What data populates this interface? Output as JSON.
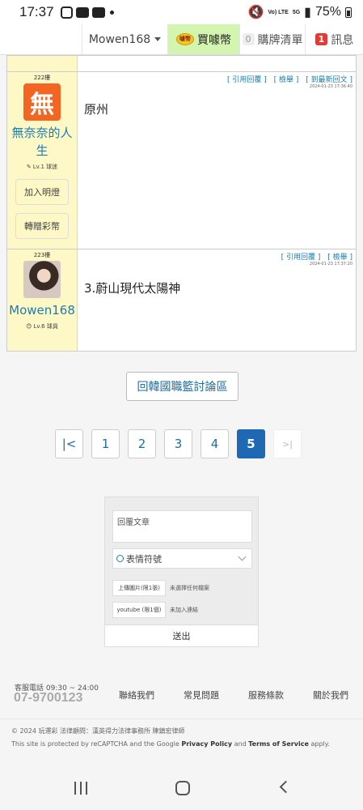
{
  "status_bar": {
    "time": "17:37",
    "network": "5G",
    "volte": "Vo) LTE",
    "battery": "75%"
  },
  "top_nav": {
    "username": "Mowen168",
    "buy_label": "買噱幣",
    "coin_text": "噱幣",
    "cart_count": "0",
    "cart_label": "購牌清單",
    "msg_count": "1",
    "msg_label": "訊息"
  },
  "posts": [
    {
      "floor": "222樓",
      "avatar_char": "無",
      "username": "無奈奈的人生",
      "level": "Lv.1 球迷",
      "actions": [
        "[ 引用回覆 ]",
        "[ 檢舉 ]",
        "[ 到最新回文 ]"
      ],
      "timestamp": "2024-01-23 17:36:40",
      "text": "原州",
      "buttons": [
        "加入明燈",
        "轉贈彩幣"
      ]
    },
    {
      "floor": "223樓",
      "username": "Mowen168",
      "level": "Lv.6 球員",
      "actions": [
        "[ 引用回覆 ]",
        "[ 檢舉 ]"
      ],
      "timestamp": "2024-01-23 17:37:20",
      "text": "3.蔚山現代太陽神"
    }
  ],
  "back_button": "回韓國職籃討論區",
  "pagination": {
    "first": "|<",
    "pages": [
      "1",
      "2",
      "3",
      "4",
      "5"
    ],
    "current": "5",
    "last": ">|"
  },
  "reply_form": {
    "placeholder": "回覆文章",
    "emoji_label": "表情符號",
    "image_button": "上傳圖片(限1張)",
    "image_note": "未選擇任何檔案",
    "youtube_button": "youtube (限1個)",
    "youtube_note": "未加入連結",
    "submit": "送出"
  },
  "footer": {
    "service_label": "客服電話 09:30 ~ 24:00",
    "phone": "07-9700123",
    "links": [
      "聯絡我們",
      "常見問題",
      "服務條款",
      "關於我們"
    ],
    "copyright": "© 2024 玩運彩 法律顧問：漢英得力法律事務所 陳鎮宏律師",
    "recaptcha_prefix": "This site is protected by reCAPTCHA and the Google",
    "privacy": "Privacy Policy",
    "and": "and",
    "terms": "Terms of Service",
    "apply": "apply."
  }
}
